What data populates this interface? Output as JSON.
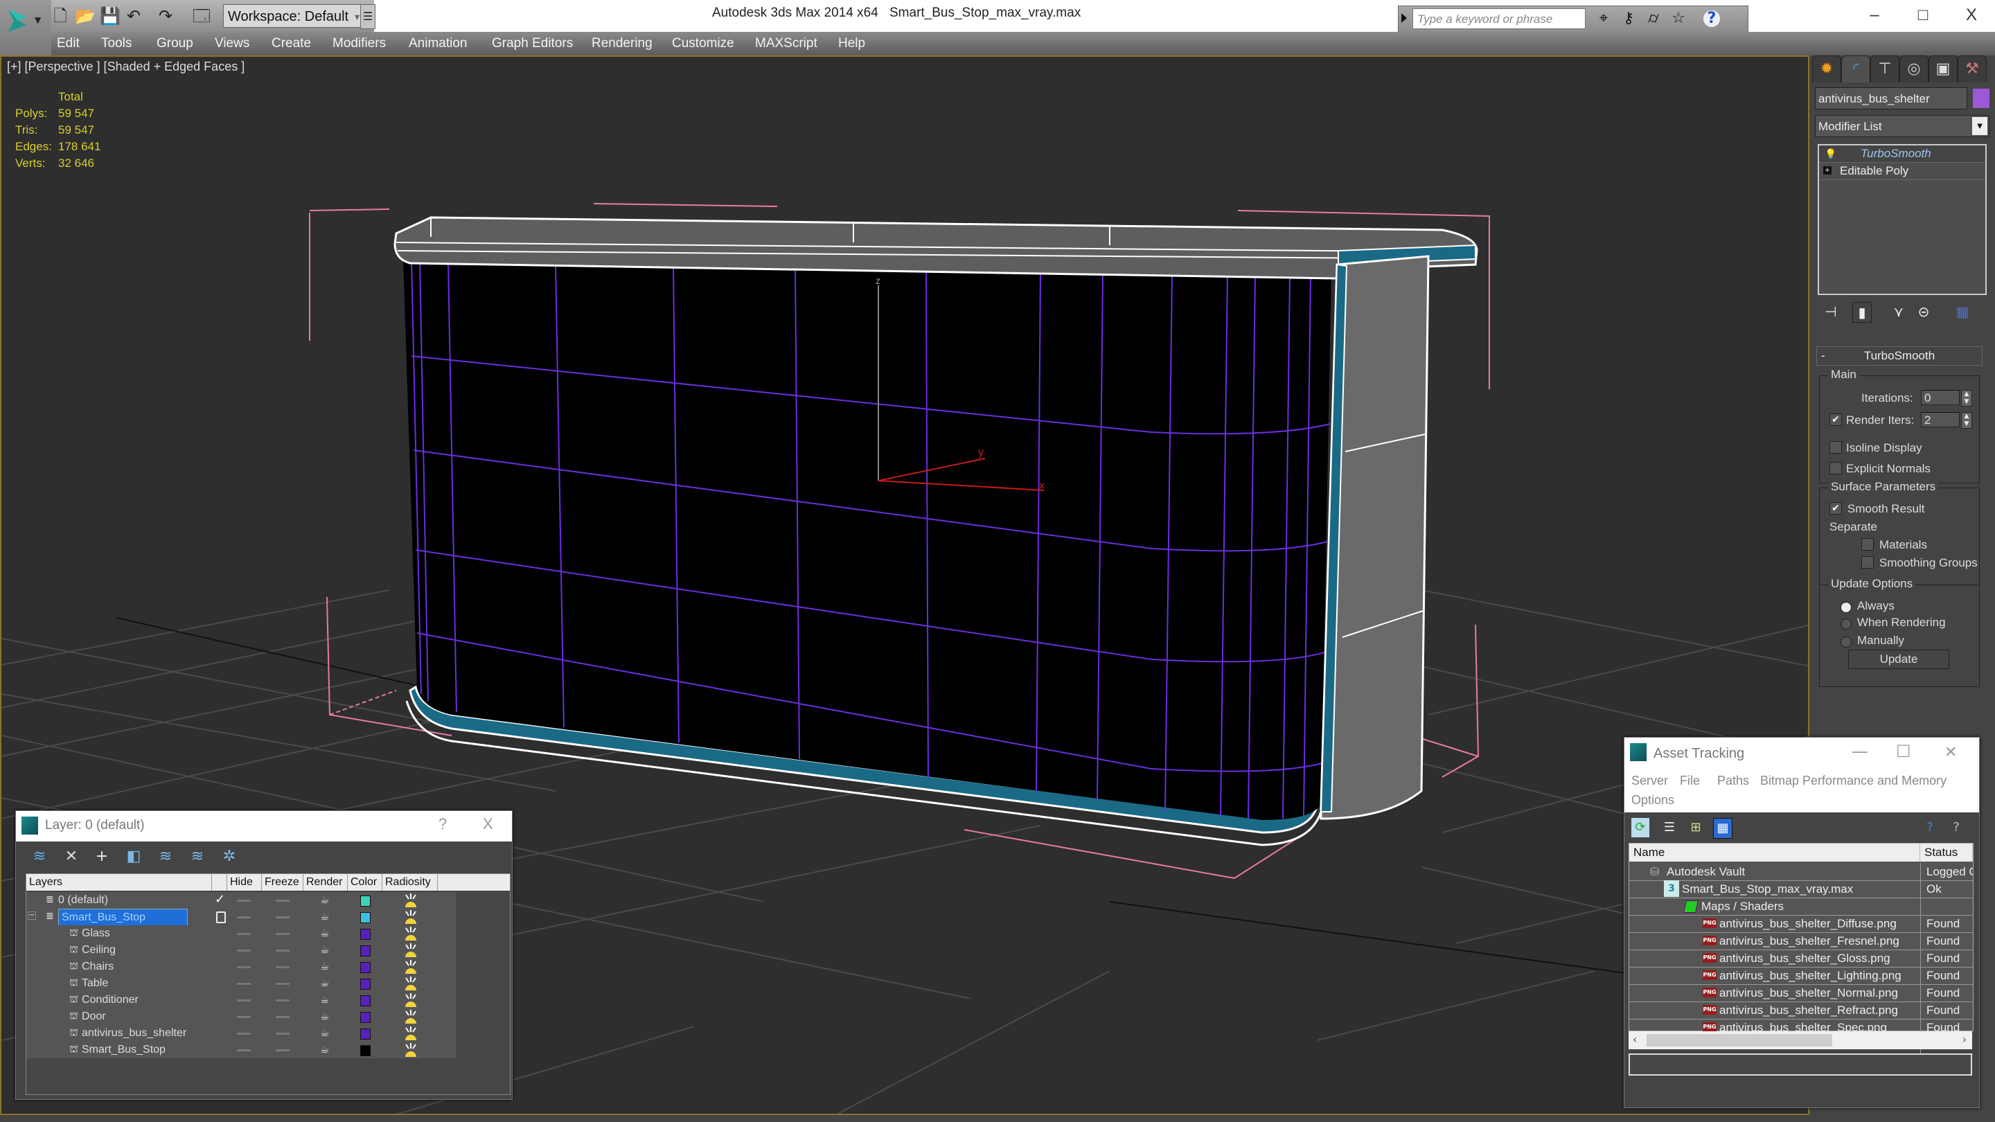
{
  "app": {
    "title": "Autodesk 3ds Max  2014 x64",
    "file": "Smart_Bus_Stop_max_vray.max",
    "workspace": "Workspace: Default",
    "search_placeholder": "Type a keyword or phrase",
    "window_controls": {
      "minimize": "–",
      "maximize": "□",
      "close": "X"
    }
  },
  "quick_access": [
    {
      "icon": "new-file-icon",
      "glyph": "🗋"
    },
    {
      "icon": "open-file-icon",
      "glyph": "📂"
    },
    {
      "icon": "save-icon",
      "glyph": "💾"
    },
    {
      "icon": "undo-icon",
      "glyph": "↶"
    },
    {
      "icon": "redo-icon",
      "glyph": "↷"
    },
    {
      "icon": "project-folder-icon",
      "glyph": "🗔"
    }
  ],
  "search_icons": [
    {
      "icon": "binoculars-icon",
      "glyph": "⌖"
    },
    {
      "icon": "key-icon",
      "glyph": "⚷"
    },
    {
      "icon": "satellite-icon",
      "glyph": "⌭"
    },
    {
      "icon": "star-icon",
      "glyph": "☆"
    },
    {
      "icon": "help-icon",
      "glyph": "?"
    }
  ],
  "menu": [
    "Edit",
    "Tools",
    "Group",
    "Views",
    "Create",
    "Modifiers",
    "Animation",
    "Graph Editors",
    "Rendering",
    "Customize",
    "MAXScript",
    "Help"
  ],
  "viewport": {
    "label": "[+] [Perspective ] [Shaded + Edged Faces ]",
    "stats": {
      "header": "Total",
      "rows": [
        {
          "k": "Polys:",
          "v": "59 547"
        },
        {
          "k": "Tris:",
          "v": "59 547"
        },
        {
          "k": "Edges:",
          "v": "178 641"
        },
        {
          "k": "Verts:",
          "v": "32 646"
        }
      ]
    },
    "gizmo": {
      "x": "x",
      "y": "y",
      "z": "z"
    }
  },
  "command_panel": {
    "tabs": [
      {
        "icon": "create-tab-icon",
        "glyph": "✹"
      },
      {
        "icon": "modify-tab-icon",
        "glyph": "◜"
      },
      {
        "icon": "hierarchy-tab-icon",
        "glyph": "⊤"
      },
      {
        "icon": "motion-tab-icon",
        "glyph": "◎"
      },
      {
        "icon": "display-tab-icon",
        "glyph": "▣"
      },
      {
        "icon": "utilities-tab-icon",
        "glyph": "⚒"
      }
    ],
    "object_name": "antivirus_bus_shelter",
    "object_color": "#9b59d6",
    "modifier_list": "Modifier List",
    "stack": [
      "TurboSmooth",
      "Editable Poly"
    ],
    "rollout": "TurboSmooth",
    "main": {
      "title": "Main",
      "iterations_label": "Iterations:",
      "iterations": "0",
      "render_iters_label": "Render Iters:",
      "render_iters": "2",
      "render_iters_checked": true,
      "isoline": "Isoline Display",
      "isoline_checked": false,
      "explicit": "Explicit Normals",
      "explicit_checked": false
    },
    "surface": {
      "title": "Surface Parameters",
      "smooth": "Smooth Result",
      "smooth_checked": true,
      "separate": "Separate",
      "materials": "Materials",
      "smoothing_groups": "Smoothing Groups"
    },
    "update": {
      "title": "Update Options",
      "options": [
        "Always",
        "When Rendering",
        "Manually"
      ],
      "selected": "Always",
      "button": "Update"
    }
  },
  "layer_dialog": {
    "title": "Layer: 0 (default)",
    "help": "?",
    "close": "X",
    "columns": [
      "Layers",
      "",
      "Hide",
      "Freeze",
      "Render",
      "Color",
      "Radiosity"
    ],
    "rows": [
      {
        "name": "0 (default)",
        "level": 0,
        "type": "layer",
        "current": true,
        "color": "#3fd4b8"
      },
      {
        "name": "Smart_Bus_Stop",
        "level": 0,
        "type": "layer",
        "selected": true,
        "color": "#3fbfe0"
      },
      {
        "name": "Glass",
        "level": 1,
        "type": "object",
        "color": "#5a1fbf"
      },
      {
        "name": "Ceiling",
        "level": 1,
        "type": "object",
        "color": "#5a1fbf"
      },
      {
        "name": "Chairs",
        "level": 1,
        "type": "object",
        "color": "#5a1fbf"
      },
      {
        "name": "Table",
        "level": 1,
        "type": "object",
        "color": "#5a1fbf"
      },
      {
        "name": "Conditioner",
        "level": 1,
        "type": "object",
        "color": "#5a1fbf"
      },
      {
        "name": "Door",
        "level": 1,
        "type": "object",
        "color": "#5a1fbf"
      },
      {
        "name": "antivirus_bus_shelter",
        "level": 1,
        "type": "object",
        "color": "#5a1fbf"
      },
      {
        "name": "Smart_Bus_Stop",
        "level": 1,
        "type": "object",
        "color": "#000000"
      }
    ]
  },
  "asset_dialog": {
    "title": "Asset Tracking",
    "menu": [
      "Server",
      "File",
      "Paths",
      "Bitmap Performance and Memory",
      "Options"
    ],
    "columns": [
      "Name",
      "Status"
    ],
    "rows": [
      {
        "name": "Autodesk Vault",
        "status": "Logged Out",
        "level": 0,
        "icon": "vault"
      },
      {
        "name": "Smart_Bus_Stop_max_vray.max",
        "status": "Ok",
        "level": 1,
        "icon": "max"
      },
      {
        "name": "Maps / Shaders",
        "status": "",
        "level": 2,
        "icon": "maps"
      },
      {
        "name": "antivirus_bus_shelter_Diffuse.png",
        "status": "Found",
        "level": 3,
        "icon": "png"
      },
      {
        "name": "antivirus_bus_shelter_Fresnel.png",
        "status": "Found",
        "level": 3,
        "icon": "png"
      },
      {
        "name": "antivirus_bus_shelter_Gloss.png",
        "status": "Found",
        "level": 3,
        "icon": "png"
      },
      {
        "name": "antivirus_bus_shelter_Lighting.png",
        "status": "Found",
        "level": 3,
        "icon": "png"
      },
      {
        "name": "antivirus_bus_shelter_Normal.png",
        "status": "Found",
        "level": 3,
        "icon": "png"
      },
      {
        "name": "antivirus_bus_shelter_Refract.png",
        "status": "Found",
        "level": 3,
        "icon": "png"
      },
      {
        "name": "antivirus_bus_shelter_Spec.png",
        "status": "Found",
        "level": 3,
        "icon": "png"
      }
    ],
    "png_badge": "PNG"
  },
  "colors": {
    "accent_border": "#8a7328",
    "stats_text": "#d8cf2a",
    "selection": "#1f6fd8",
    "wire_purple": "#6a2ee0",
    "bbox_pink": "#e87aa8",
    "teal_trim": "#1a6a86"
  }
}
